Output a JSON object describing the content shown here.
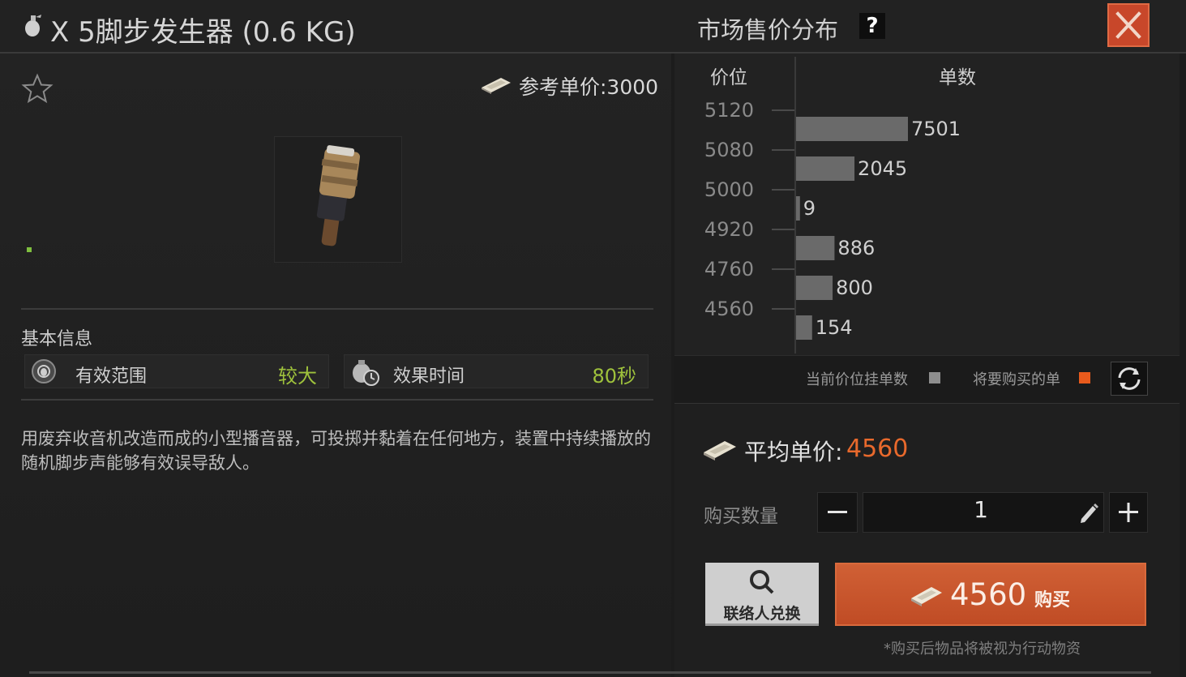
{
  "header": {
    "item_title": "X 5脚步发生器 (0.6 KG)",
    "market_title": "市场售价分布",
    "help_label": "?"
  },
  "item": {
    "ref_price_label": "参考单价:3000",
    "basic_info_label": "基本信息",
    "stats": [
      {
        "name": "有效范围",
        "value": "较大"
      },
      {
        "name": "效果时间",
        "value": "80秒"
      }
    ],
    "description": "用废弃收音机改造而成的小型播音器，可投掷并黏着在任何地方，装置中持续播放的随机脚步声能够有效误导敌人。"
  },
  "chart_data": {
    "type": "bar",
    "orientation": "horizontal",
    "xlabel": "单数",
    "ylabel": "价位",
    "categories": [
      "5120",
      "5080",
      "5000",
      "4920",
      "4760",
      "4560"
    ],
    "values": [
      7501,
      2045,
      9,
      886,
      800,
      154
    ],
    "max_value": 7501,
    "bar_color": "#6a6a6a"
  },
  "legend": {
    "current_label": "当前价位挂单数",
    "current_color": "#8e8e8e",
    "buy_label": "将要购买的单",
    "buy_color": "#e85a1c"
  },
  "purchase": {
    "avg_label": "平均单价:",
    "avg_value": "4560",
    "qty_label": "购买数量",
    "qty_value": "1",
    "contact_label": "联络人兑换",
    "buy_price": "4560",
    "buy_label": "购买",
    "footnote": "*购买后物品将被视为行动物资"
  },
  "colors": {
    "accent": "#e8692c",
    "stat_value": "#9fc23c",
    "close_button": "#c8472a"
  }
}
